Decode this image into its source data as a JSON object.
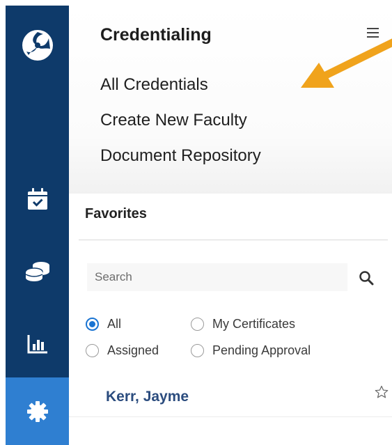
{
  "sidebar": {
    "icons": [
      "logo-icon",
      "calendar-check-icon",
      "coins-icon",
      "bar-chart-icon",
      "gear-icon"
    ],
    "active_index": 4,
    "colors": {
      "background": "#0e3a6a",
      "active": "#2f7fd1"
    }
  },
  "panel": {
    "title": "Credentialing",
    "menu": [
      "All Credentials",
      "Create New Faculty",
      "Document Repository"
    ]
  },
  "favorites": {
    "heading": "Favorites",
    "search_placeholder": "Search",
    "filters": [
      {
        "label": "All",
        "checked": true
      },
      {
        "label": "My Certificates",
        "checked": false
      },
      {
        "label": "Assigned",
        "checked": false
      },
      {
        "label": "Pending Approval",
        "checked": false
      }
    ],
    "items": [
      {
        "name": "Kerr, Jayme",
        "starred": false
      }
    ]
  },
  "annotation": {
    "type": "arrow",
    "color": "#f0a31c",
    "points_to": "All Credentials"
  }
}
